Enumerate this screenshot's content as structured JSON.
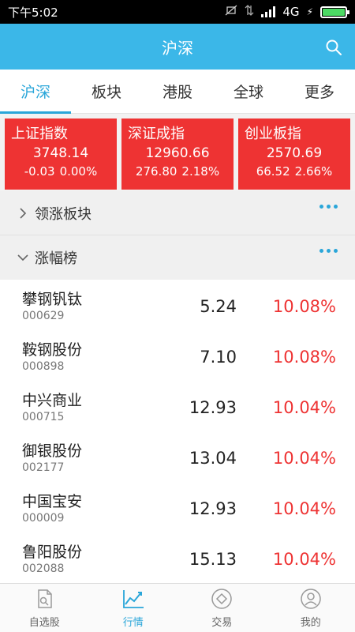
{
  "status_bar": {
    "time": "下午5:02",
    "network": "4G"
  },
  "header": {
    "title": "沪深"
  },
  "tabs": [
    {
      "label": "沪深",
      "active": true
    },
    {
      "label": "板块",
      "active": false
    },
    {
      "label": "港股",
      "active": false
    },
    {
      "label": "全球",
      "active": false
    },
    {
      "label": "更多",
      "active": false
    }
  ],
  "indices": [
    {
      "name": "上证指数",
      "value": "3748.14",
      "change": "-0.03",
      "pct": "0.00%"
    },
    {
      "name": "深证成指",
      "value": "12960.66",
      "change": "276.80",
      "pct": "2.18%"
    },
    {
      "name": "创业板指",
      "value": "2570.69",
      "change": "66.52",
      "pct": "2.66%"
    }
  ],
  "sections": {
    "leading_sectors": {
      "label": "领涨板块"
    },
    "gainers": {
      "label": "涨幅榜"
    }
  },
  "stocks": [
    {
      "name": "攀钢钒钛",
      "code": "000629",
      "price": "5.24",
      "pct": "10.08%"
    },
    {
      "name": "鞍钢股份",
      "code": "000898",
      "price": "7.10",
      "pct": "10.08%"
    },
    {
      "name": "中兴商业",
      "code": "000715",
      "price": "12.93",
      "pct": "10.04%"
    },
    {
      "name": "御银股份",
      "code": "002177",
      "price": "13.04",
      "pct": "10.04%"
    },
    {
      "name": "中国宝安",
      "code": "000009",
      "price": "12.93",
      "pct": "10.04%"
    },
    {
      "name": "鲁阳股份",
      "code": "002088",
      "price": "15.13",
      "pct": "10.04%"
    }
  ],
  "bottom_nav": [
    {
      "label": "自选股",
      "icon": "watchlist-icon",
      "active": false
    },
    {
      "label": "行情",
      "icon": "market-chart-icon",
      "active": true
    },
    {
      "label": "交易",
      "icon": "trade-icon",
      "active": false
    },
    {
      "label": "我的",
      "icon": "profile-icon",
      "active": false
    }
  ],
  "colors": {
    "accent": "#2aa6d9",
    "header": "#3bb7e8",
    "up": "#e33333",
    "card": "#ee3333"
  }
}
